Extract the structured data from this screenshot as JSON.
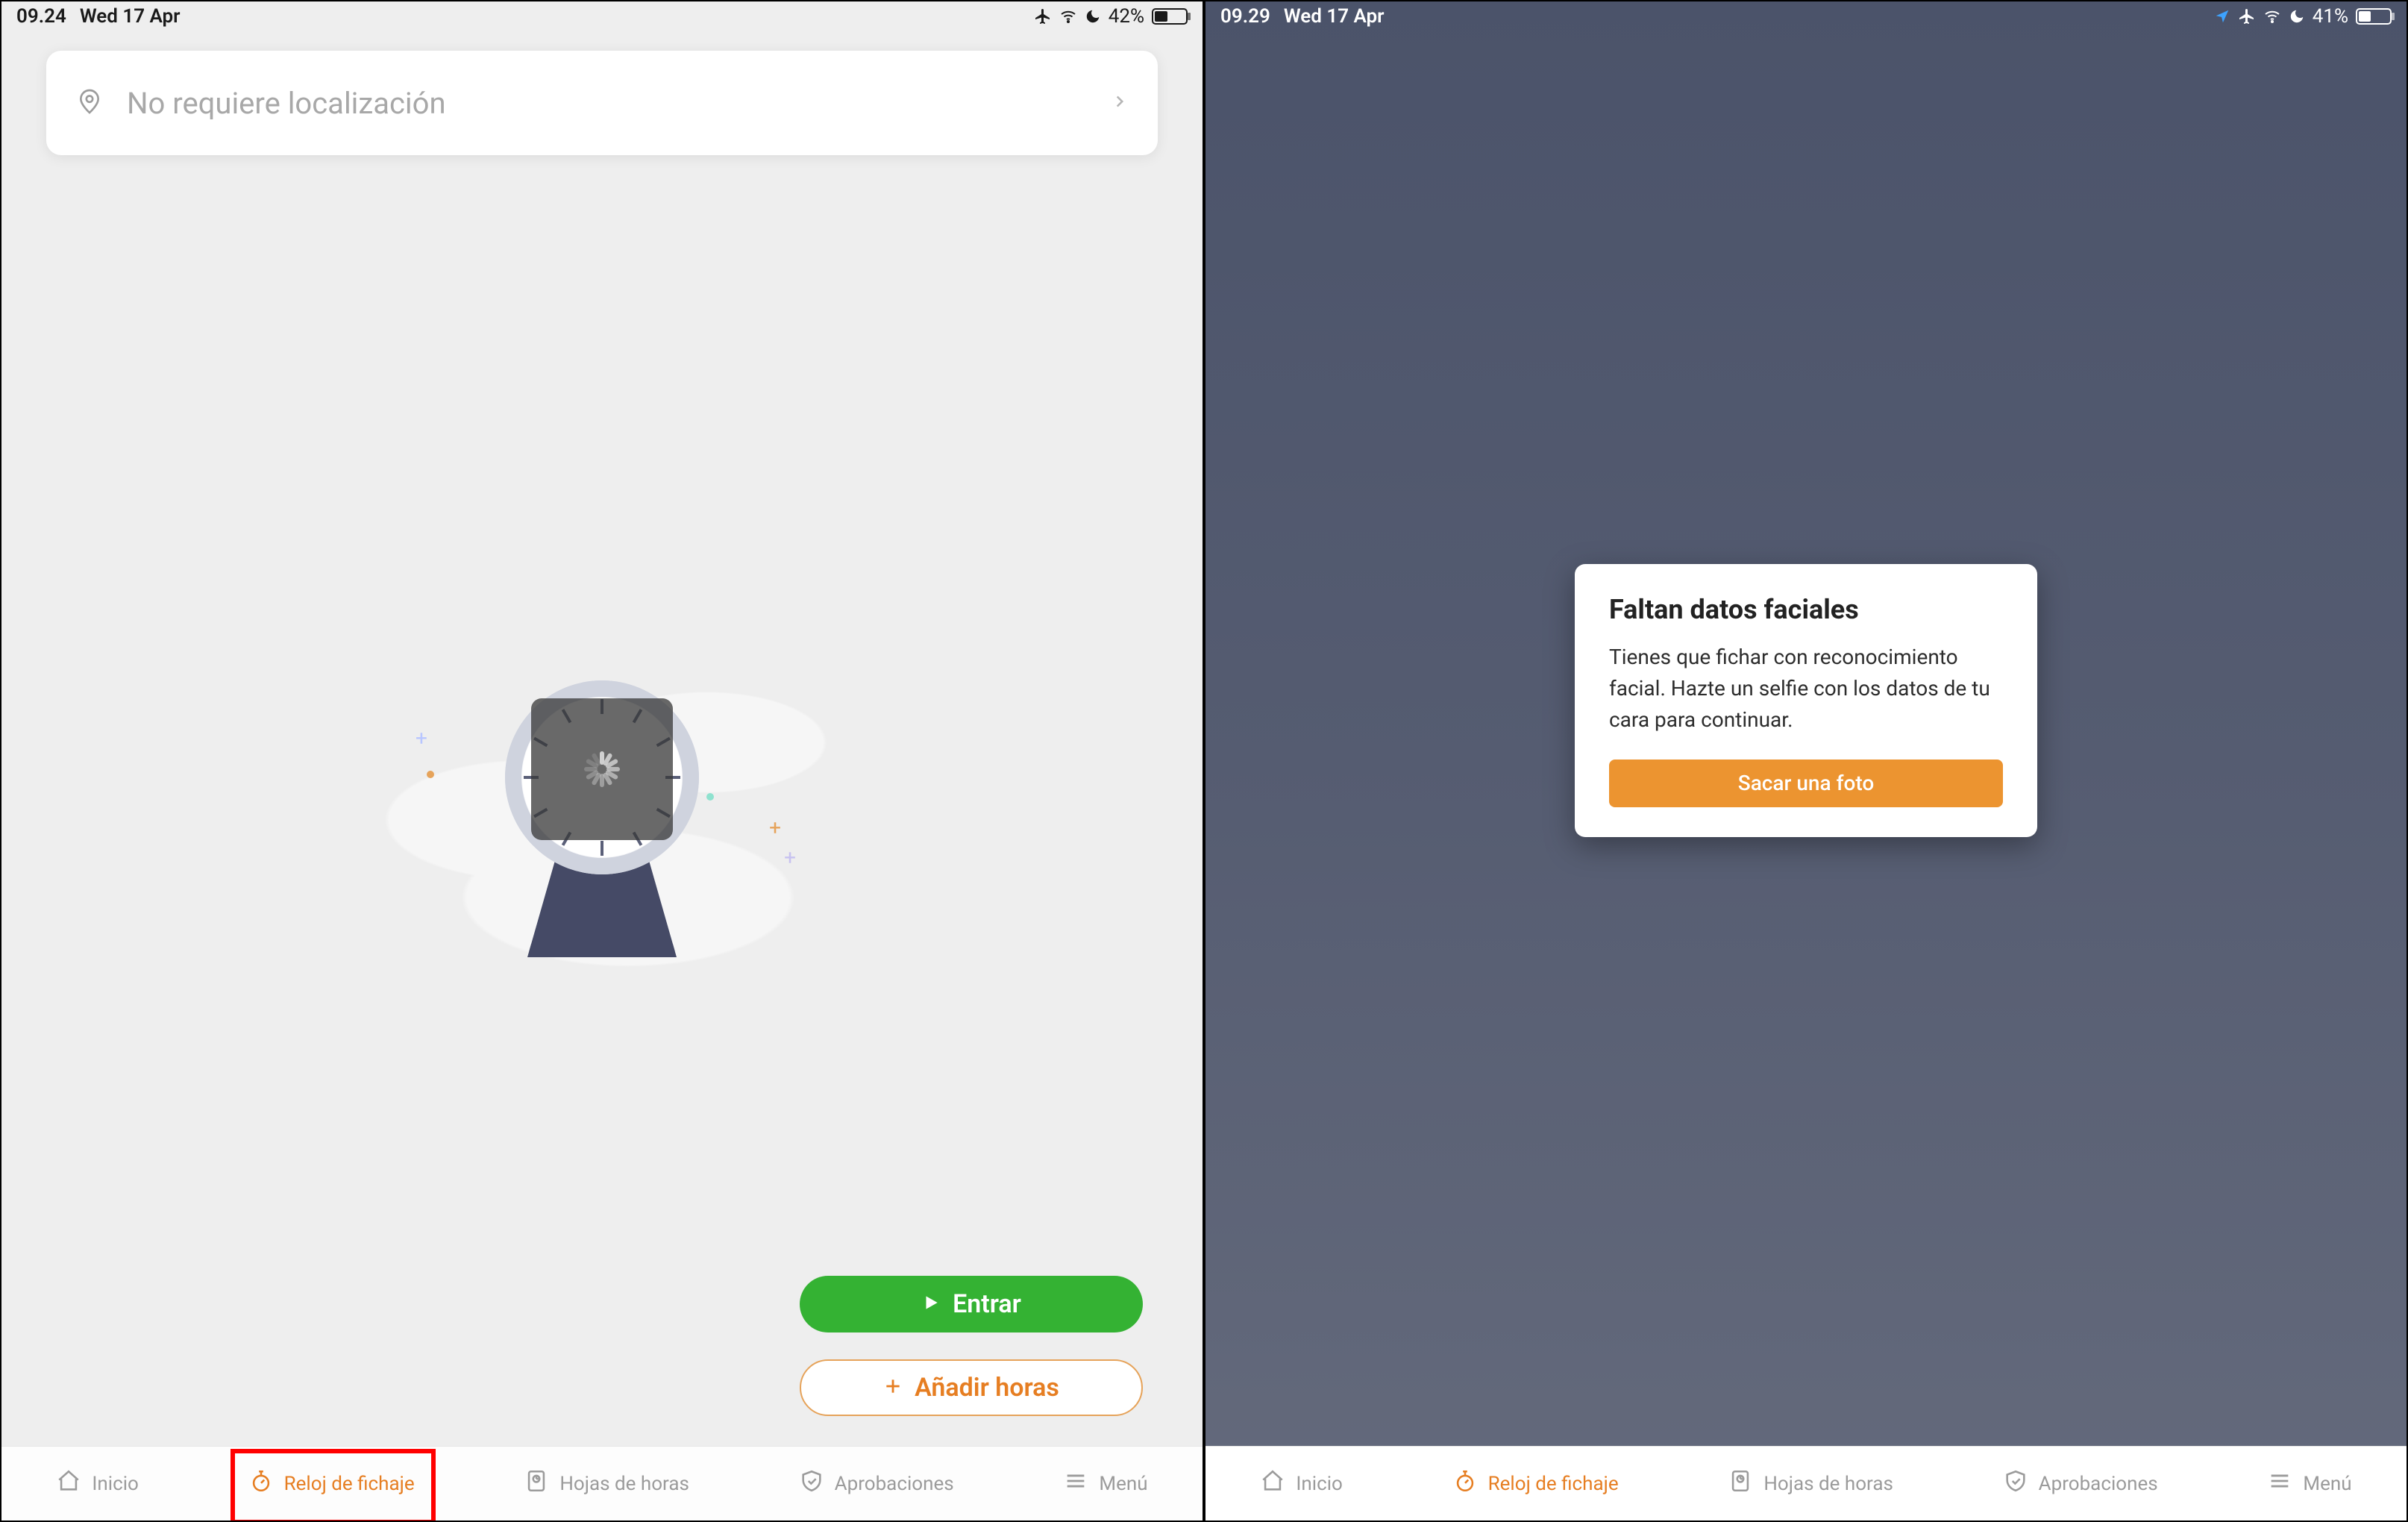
{
  "left": {
    "status": {
      "time": "09.24",
      "date": "Wed 17 Apr",
      "battery_pct": "42%",
      "battery_fill": 42
    },
    "location_label": "No requiere localización",
    "buttons": {
      "enter": "Entrar",
      "add_hours": "Añadir horas"
    },
    "tabs": [
      {
        "icon": "home",
        "label": "Inicio"
      },
      {
        "icon": "stopwatch",
        "label": "Reloj de fichaje"
      },
      {
        "icon": "sheet",
        "label": "Hojas de horas"
      },
      {
        "icon": "shield",
        "label": "Aprobaciones"
      },
      {
        "icon": "menu",
        "label": "Menú"
      }
    ],
    "active_tab_index": 1,
    "highlight_tab_index": 1
  },
  "right": {
    "status": {
      "time": "09.29",
      "date": "Wed 17 Apr",
      "battery_pct": "41%",
      "battery_fill": 41
    },
    "modal": {
      "title": "Faltan datos faciales",
      "body": "Tienes que fichar con reconocimiento facial. Hazte un selfie con los datos de tu cara para continuar.",
      "cta": "Sacar una foto"
    },
    "tabs": [
      {
        "icon": "home",
        "label": "Inicio"
      },
      {
        "icon": "stopwatch",
        "label": "Reloj de fichaje"
      },
      {
        "icon": "sheet",
        "label": "Hojas de horas"
      },
      {
        "icon": "shield",
        "label": "Aprobaciones"
      },
      {
        "icon": "menu",
        "label": "Menú"
      }
    ],
    "active_tab_index": 1
  },
  "colors": {
    "accent_orange": "#e67e22",
    "accent_green": "#34b233"
  }
}
